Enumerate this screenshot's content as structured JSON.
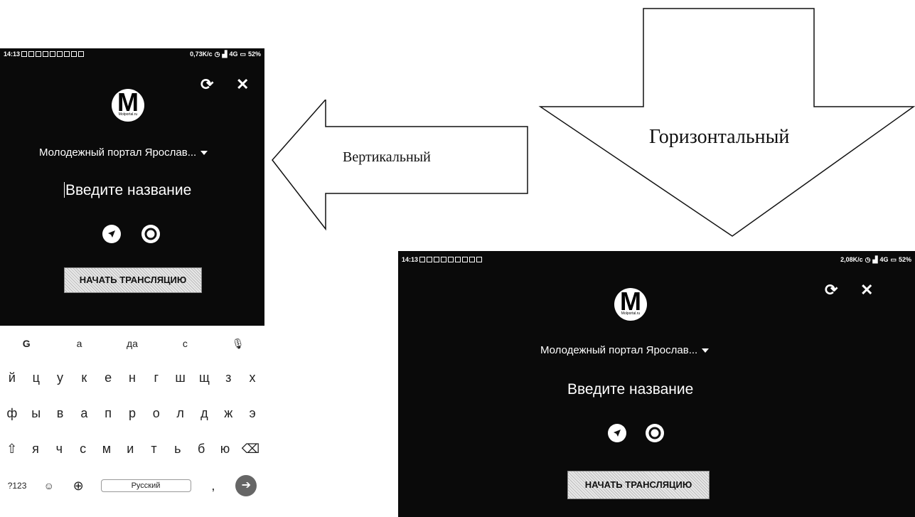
{
  "status_left": {
    "time": "14:13",
    "speed": "0,73K/c",
    "network": "4G",
    "battery": "52%"
  },
  "status_right": {
    "time": "14:13",
    "speed": "2,08K/c",
    "network": "4G",
    "battery": "52%"
  },
  "app": {
    "logo_letter": "M",
    "logo_caption": "Molportal.ru",
    "portal_label": "Молодежный портал Ярослав...",
    "title_placeholder": "Введите название",
    "start_button": "НАЧАТЬ ТРАНСЛЯЦИЮ"
  },
  "keyboard": {
    "suggestions": [
      "G",
      "а",
      "да",
      "с"
    ],
    "row1": [
      "й",
      "ц",
      "у",
      "к",
      "е",
      "н",
      "г",
      "ш",
      "щ",
      "з",
      "х"
    ],
    "row2": [
      "ф",
      "ы",
      "в",
      "а",
      "п",
      "р",
      "о",
      "л",
      "д",
      "ж",
      "э"
    ],
    "row3": [
      "я",
      "ч",
      "с",
      "м",
      "и",
      "т",
      "ь",
      "б",
      "ю"
    ],
    "mode_key": "?123",
    "space_label": "Русский"
  },
  "labels": {
    "vertical": "Вертикальный",
    "horizontal": "Горизонтальный"
  }
}
